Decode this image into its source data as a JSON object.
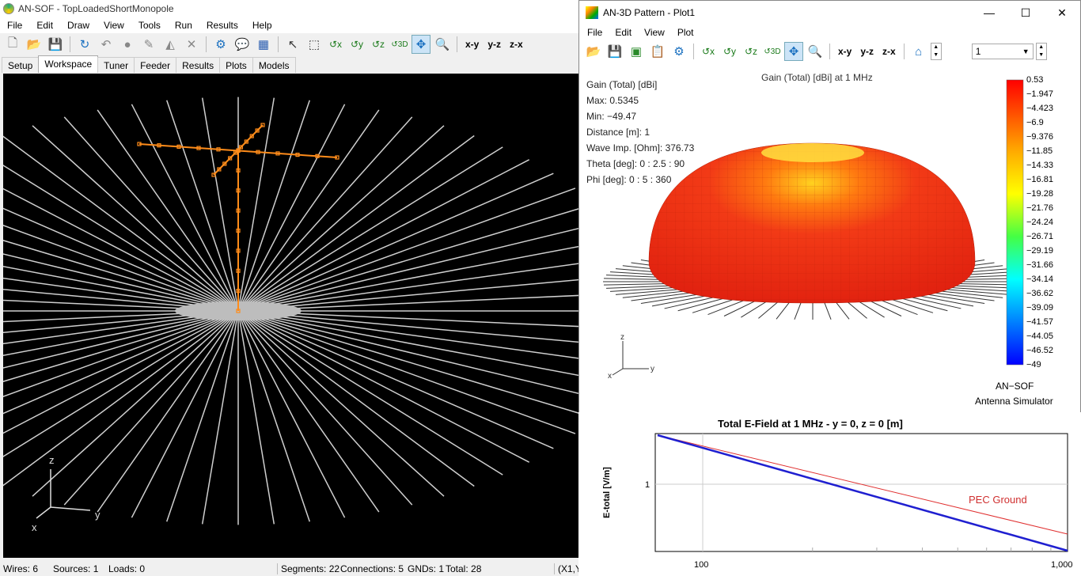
{
  "main_window": {
    "title": "AN-SOF - TopLoadedShortMonopole",
    "menu": [
      "File",
      "Edit",
      "Draw",
      "View",
      "Tools",
      "Run",
      "Results",
      "Help"
    ],
    "toolbar_text": [
      "x-y",
      "y-z",
      "z-x"
    ],
    "tabs": [
      "Setup",
      "Workspace",
      "Tuner",
      "Feeder",
      "Results",
      "Plots",
      "Models"
    ],
    "active_tab": "Workspace",
    "axis_labels": {
      "x": "x",
      "y": "y",
      "z": "z"
    },
    "status": {
      "wires": "Wires: 6",
      "sources": "Sources: 1",
      "loads": "Loads: 0",
      "segments": "Segments: 22",
      "connections": "Connections: 5",
      "gnds": "GNDs: 1",
      "total": "Total: 28",
      "coords": "(X1,Y"
    },
    "colors": {
      "antenna": "#ff8c1a",
      "radials": "#d0d0d0",
      "background": "#000000"
    }
  },
  "plot_window": {
    "title": "AN-3D Pattern - Plot1",
    "menu": [
      "File",
      "Edit",
      "View",
      "Plot"
    ],
    "toolbar_text": [
      "x-y",
      "y-z",
      "z-x"
    ],
    "combo_value": "1",
    "plot_title": "Gain (Total) [dBi] at 1 MHz",
    "info": [
      "Gain (Total) [dBi]",
      "Max: 0.5345",
      "Min: −49.47",
      "Distance [m]: 1",
      "Wave Imp. [Ohm]: 376.73",
      "Theta [deg]: 0 : 2.5 : 90",
      "Phi [deg]: 0 : 5 : 360"
    ],
    "colorbar": [
      "0.53",
      "−1.947",
      "−4.423",
      "−6.9",
      "−9.376",
      "−11.85",
      "−14.33",
      "−16.81",
      "−19.28",
      "−21.76",
      "−24.24",
      "−26.71",
      "−29.19",
      "−31.66",
      "−34.14",
      "−36.62",
      "−39.09",
      "−41.57",
      "−44.05",
      "−46.52",
      "−49"
    ],
    "brand": "AN−SOF",
    "brand_sub": "Antenna Simulator",
    "axis_labels": {
      "x": "x",
      "y": "y",
      "z": "z"
    }
  },
  "efield_plot": {
    "title": "Total E-Field at 1 MHz - y = 0, z = 0 [m]",
    "ylabel": "E-total [V/m]",
    "ytick": "1",
    "xticks": [
      "100",
      "1,000"
    ],
    "legend": "PEC Ground",
    "colors": {
      "blue": "#1f1fd0",
      "red": "#e03030"
    }
  }
}
